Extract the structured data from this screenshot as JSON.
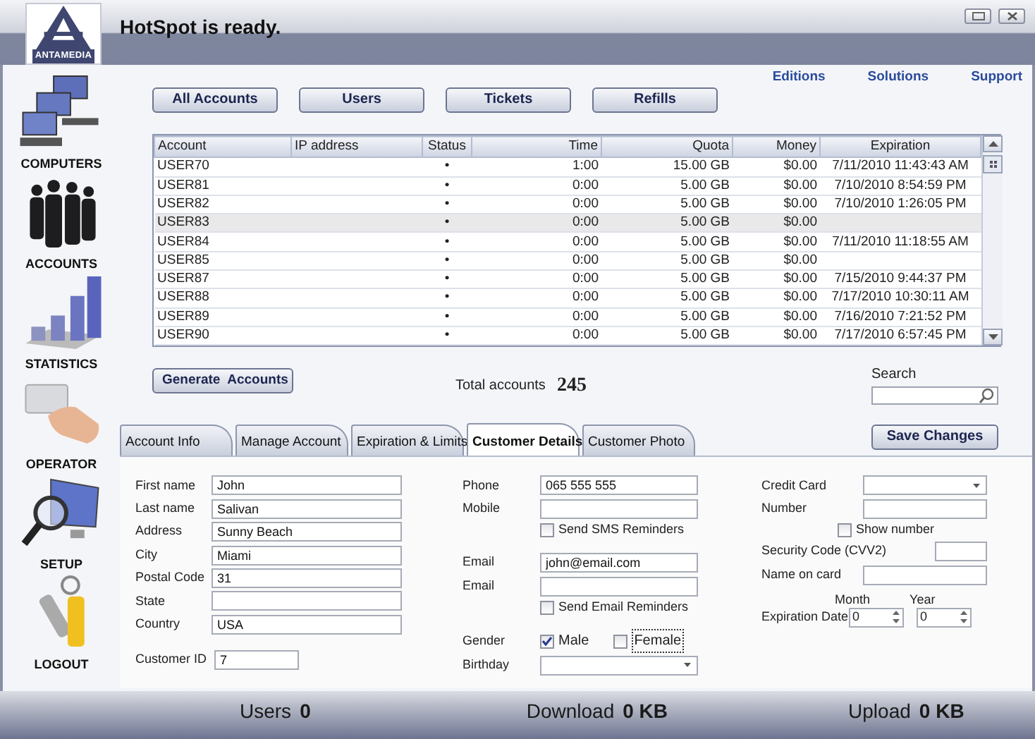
{
  "header": {
    "logo_text": "ANTAMEDIA",
    "title": "HotSpot is ready."
  },
  "sidebar": {
    "items": [
      {
        "label": "COMPUTERS"
      },
      {
        "label": "ACCOUNTS"
      },
      {
        "label": "STATISTICS"
      },
      {
        "label": "OPERATOR"
      },
      {
        "label": "SETUP"
      },
      {
        "label": "LOGOUT"
      }
    ]
  },
  "top_links": [
    "Editions",
    "Solutions",
    "Support"
  ],
  "filter_buttons": [
    "All Accounts",
    "Users",
    "Tickets",
    "Refills"
  ],
  "table": {
    "columns": [
      "Account",
      "IP address",
      "Status",
      "Time",
      "Quota",
      "Money",
      "Expiration"
    ],
    "rows": [
      {
        "cells": [
          "USER70",
          null,
          "•",
          "1:00",
          "15.00 GB",
          "$0.00",
          "7/11/2010 11:43:43 AM"
        ],
        "selected": false
      },
      {
        "cells": [
          "USER81",
          null,
          "•",
          "0:00",
          "5.00 GB",
          "$0.00",
          "7/10/2010 8:54:59 PM"
        ],
        "selected": false
      },
      {
        "cells": [
          "USER82",
          null,
          "•",
          "0:00",
          "5.00 GB",
          "$0.00",
          "7/10/2010 1:26:05 PM"
        ],
        "selected": false
      },
      {
        "cells": [
          "USER83",
          null,
          "•",
          "0:00",
          "5.00 GB",
          "$0.00",
          null
        ],
        "selected": true
      },
      {
        "cells": [
          "USER84",
          null,
          "•",
          "0:00",
          "5.00 GB",
          "$0.00",
          "7/11/2010 11:18:55 AM"
        ],
        "selected": false
      },
      {
        "cells": [
          "USER85",
          null,
          "•",
          "0:00",
          "5.00 GB",
          "$0.00",
          null
        ],
        "selected": false
      },
      {
        "cells": [
          "USER87",
          null,
          "•",
          "0:00",
          "5.00 GB",
          "$0.00",
          "7/15/2010 9:44:37 PM"
        ],
        "selected": false
      },
      {
        "cells": [
          "USER88",
          null,
          "•",
          "0:00",
          "5.00 GB",
          "$0.00",
          "7/17/2010 10:30:11 AM"
        ],
        "selected": false
      },
      {
        "cells": [
          "USER89",
          null,
          "•",
          "0:00",
          "5.00 GB",
          "$0.00",
          "7/16/2010 7:21:52 PM"
        ],
        "selected": false
      },
      {
        "cells": [
          "USER90",
          null,
          "•",
          "0:00",
          "5.00 GB",
          "$0.00",
          "7/17/2010 6:57:45 PM"
        ],
        "selected": false
      }
    ]
  },
  "generate_button": "Generate  Accounts",
  "total": {
    "label": "Total accounts",
    "value": "245"
  },
  "search": {
    "label": "Search"
  },
  "tabs": [
    {
      "label": "Account Info",
      "selected": false
    },
    {
      "label": "Manage Account",
      "selected": false
    },
    {
      "label": "Expiration & Limits",
      "selected": false
    },
    {
      "label": "Customer Details",
      "selected": true
    },
    {
      "label": "Customer Photo",
      "selected": false
    }
  ],
  "save_button": "Save Changes",
  "form": {
    "personal": [
      {
        "label": "First name",
        "value": "John"
      },
      {
        "label": "Last name",
        "value": "Salivan"
      },
      {
        "label": "Address",
        "value": "Sunny Beach"
      },
      {
        "label": "City",
        "value": "Miami"
      },
      {
        "label": "Postal Code",
        "value": "31"
      },
      {
        "label": "State"
      },
      {
        "label": "Country",
        "value": "USA"
      }
    ],
    "customer_id": {
      "label": "Customer ID",
      "value": "7"
    },
    "contact": [
      {
        "kind": "field",
        "label": "Phone",
        "value": "065 555 555"
      },
      {
        "kind": "field",
        "label": "Mobile"
      },
      {
        "kind": "checkbox",
        "label": "Send SMS Reminders",
        "checked": false
      },
      {
        "kind": "field",
        "label": "Email",
        "value": "john@email.com"
      },
      {
        "kind": "field",
        "label": "Email"
      },
      {
        "kind": "checkbox",
        "label": "Send Email Reminders",
        "checked": false
      },
      {
        "kind": "options",
        "label": "Gender",
        "options": [
          {
            "label": "Male",
            "checked": true,
            "focused": false
          },
          {
            "label": "Female",
            "checked": false,
            "focused": true
          }
        ]
      },
      {
        "kind": "select",
        "label": "Birthday"
      }
    ],
    "payment": [
      {
        "kind": "select",
        "label": "Credit Card"
      },
      {
        "kind": "field",
        "label": "Number"
      },
      {
        "kind": "checkbox",
        "label": "Show number",
        "checked": false
      },
      {
        "kind": "short_field",
        "label": "Security Code (CVV2)"
      },
      {
        "kind": "field",
        "label": "Name on card"
      },
      {
        "kind": "date",
        "label": "Expiration Date",
        "parts": [
          {
            "label": "Month",
            "value": "0"
          },
          {
            "label": "Year",
            "value": "0"
          }
        ]
      }
    ]
  },
  "status_bar": [
    {
      "label": "Users",
      "value": "0"
    },
    {
      "label": "Download",
      "value": "0 KB"
    },
    {
      "label": "Upload",
      "value": "0 KB"
    }
  ]
}
